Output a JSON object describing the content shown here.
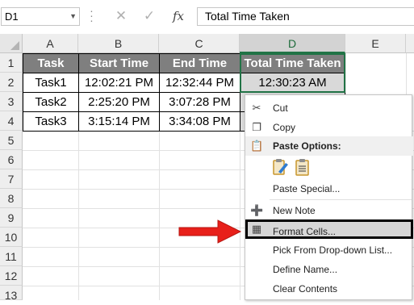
{
  "formula_bar": {
    "name_box": "D1",
    "cancel_icon": "cancel-icon",
    "enter_icon": "enter-icon",
    "fx_label": "fx",
    "content": "Total Time Taken"
  },
  "grid": {
    "columns": [
      "A",
      "B",
      "C",
      "D",
      "E"
    ],
    "rows": [
      "1",
      "2",
      "3",
      "4",
      "5",
      "6",
      "7",
      "8",
      "9",
      "10",
      "11",
      "12",
      "13"
    ],
    "cells": {
      "A1": "Task",
      "B1": "Start Time",
      "C1": "End Time",
      "D1": "Total Time Taken",
      "A2": "Task1",
      "B2": "12:02:21 PM",
      "C2": "12:32:44 PM",
      "D2": "12:30:23 AM",
      "A3": "Task2",
      "B3": "2:25:20 PM",
      "C3": "3:07:28 PM",
      "A4": "Task3",
      "B4": "3:15:14 PM",
      "C4": "3:34:08 PM"
    },
    "selected_column": "D",
    "colors": {
      "header_fill": "#7f7f7f",
      "selection": "#217346",
      "shaded_fill": "#d9d9d9"
    }
  },
  "context_menu": {
    "cut": "Cut",
    "copy": "Copy",
    "paste_options": "Paste Options:",
    "paste_special": "Paste Special...",
    "new_note": "New Note",
    "format_cells": "Format Cells...",
    "pick_dropdown": "Pick From Drop-down List...",
    "define_name": "Define Name...",
    "clear_contents": "Clear Contents"
  },
  "annotation": {
    "arrow_color": "#e8201a"
  }
}
